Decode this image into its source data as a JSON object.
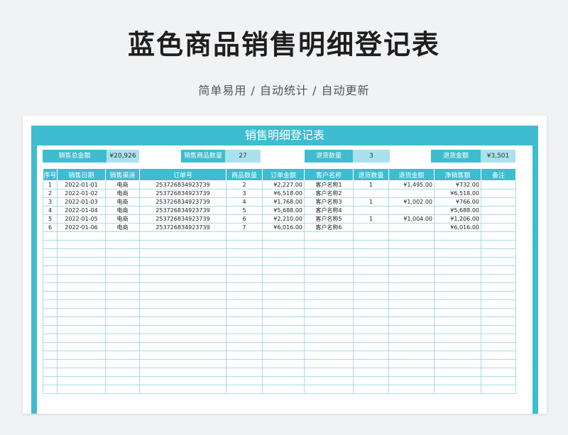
{
  "page": {
    "title": "蓝色商品销售明细登记表",
    "subtitle": "简单易用 / 自动统计 / 自动更新"
  },
  "sheet": {
    "title": "销售明细登记表",
    "summary": [
      {
        "label": "销售总金额",
        "value": "¥20,926"
      },
      {
        "label": "销售商品数量",
        "value": "27"
      },
      {
        "label": "退货数量",
        "value": "3"
      },
      {
        "label": "退货金额",
        "value": "¥3,501"
      }
    ],
    "columns": [
      "序号",
      "销售日期",
      "销售渠道",
      "订单号",
      "商品数量",
      "订单金额",
      "客户名称",
      "退货数量",
      "退货金额",
      "净销售额",
      "备注"
    ],
    "rows": [
      [
        "1",
        "2022-01-01",
        "电商",
        "253726834923739",
        "2",
        "¥2,227.00",
        "客户名称1",
        "1",
        "¥1,495.00",
        "¥732.00",
        ""
      ],
      [
        "2",
        "2022-01-02",
        "电商",
        "253726834923739",
        "3",
        "¥6,518.00",
        "客户名称2",
        "",
        "",
        "¥6,518.00",
        ""
      ],
      [
        "3",
        "2022-01-03",
        "电商",
        "253726834923739",
        "4",
        "¥1,768.00",
        "客户名称3",
        "1",
        "¥1,002.00",
        "¥766.00",
        ""
      ],
      [
        "4",
        "2022-01-04",
        "电商",
        "253726834923739",
        "5",
        "¥5,688.00",
        "客户名称4",
        "",
        "",
        "¥5,688.00",
        ""
      ],
      [
        "5",
        "2022-01-05",
        "电商",
        "253726834923739",
        "6",
        "¥2,210.00",
        "客户名称5",
        "1",
        "¥1,004.00",
        "¥1,206.00",
        ""
      ],
      [
        "6",
        "2022-01-06",
        "电商",
        "253726834923739",
        "7",
        "¥6,016.00",
        "客户名称6",
        "",
        "",
        "¥6,016.00",
        ""
      ]
    ],
    "empty_rows": 19
  },
  "colors": {
    "accent": "#3fbccf",
    "accent_light": "#a9e2ec",
    "grid": "#a8dbe4"
  }
}
